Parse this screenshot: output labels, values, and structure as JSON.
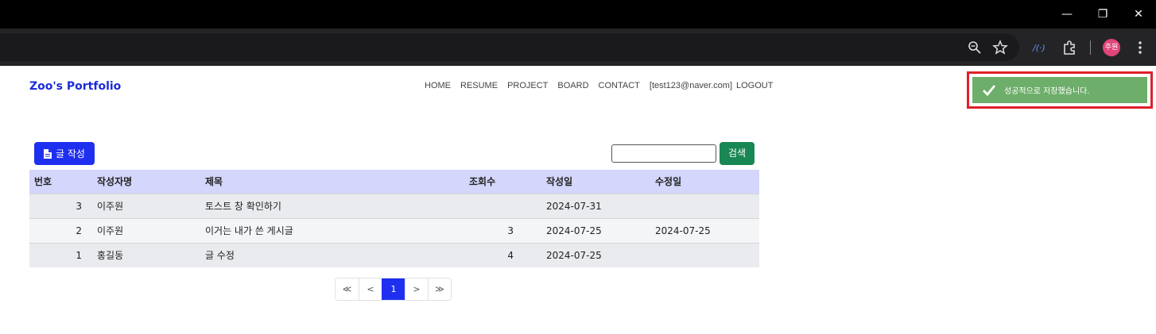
{
  "window": {
    "minimize": "—",
    "restore": "❐",
    "close": "✕"
  },
  "browser": {
    "profile_label": "주원"
  },
  "site": {
    "brand": "Zoo's Portfolio",
    "nav": [
      "HOME",
      "RESUME",
      "PROJECT",
      "BOARD",
      "CONTACT",
      "[test123@naver.com]",
      "LOGOUT"
    ]
  },
  "toast": {
    "message": "성공적으로 저장했습니다.",
    "color": "#6dae6a"
  },
  "actions": {
    "write_label": "글 작성",
    "search_value": "",
    "search_label": "검색"
  },
  "table": {
    "headers": {
      "no": "번호",
      "author": "작성자명",
      "title": "제목",
      "views": "조회수",
      "created": "작성일",
      "updated": "수정일"
    },
    "rows": [
      {
        "no": "3",
        "author": "이주원",
        "title": "토스트 창 확인하기",
        "views": "",
        "created": "2024-07-31",
        "updated": ""
      },
      {
        "no": "2",
        "author": "이주원",
        "title": "이거는 내가 쓴 게시글",
        "views": "3",
        "created": "2024-07-25",
        "updated": "2024-07-25"
      },
      {
        "no": "1",
        "author": "홍길동",
        "title": "글 수정",
        "views": "4",
        "created": "2024-07-25",
        "updated": ""
      }
    ]
  },
  "pagination": {
    "first": "≪",
    "prev": "<",
    "current": "1",
    "next": ">",
    "last": "≫"
  }
}
